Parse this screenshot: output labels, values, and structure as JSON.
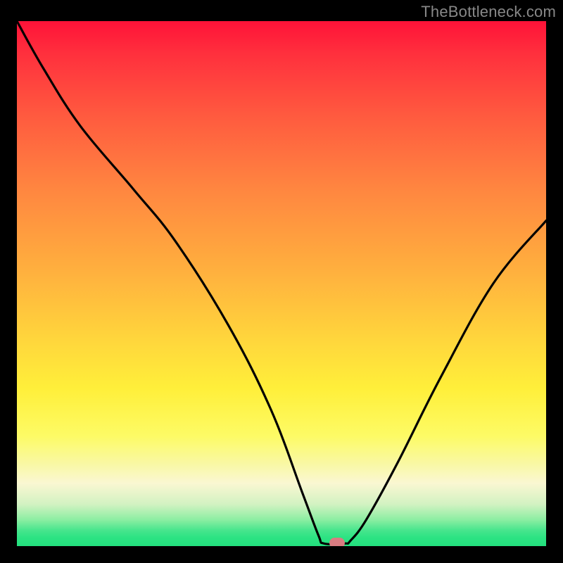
{
  "watermark": "TheBottleneck.com",
  "chart_data": {
    "type": "line",
    "title": "",
    "xlabel": "",
    "ylabel": "",
    "xlim": [
      0,
      100
    ],
    "ylim": [
      0,
      100
    ],
    "series": [
      {
        "name": "curve",
        "x": [
          0,
          5,
          12,
          22,
          30,
          40,
          48,
          54,
          57,
          58,
          62,
          63,
          66,
          72,
          80,
          90,
          100
        ],
        "values": [
          100,
          91,
          80,
          68,
          58,
          42,
          26,
          10,
          2,
          0.5,
          0.5,
          1,
          5,
          16,
          32,
          50,
          62
        ]
      }
    ],
    "marker": {
      "x": 60.5,
      "y": 0.5
    },
    "colors": {
      "curve": "#000000",
      "marker": "#d97c81",
      "gradient_top": "#ff1238",
      "gradient_mid": "#ffd43c",
      "gradient_bottom": "#23e07e"
    }
  }
}
